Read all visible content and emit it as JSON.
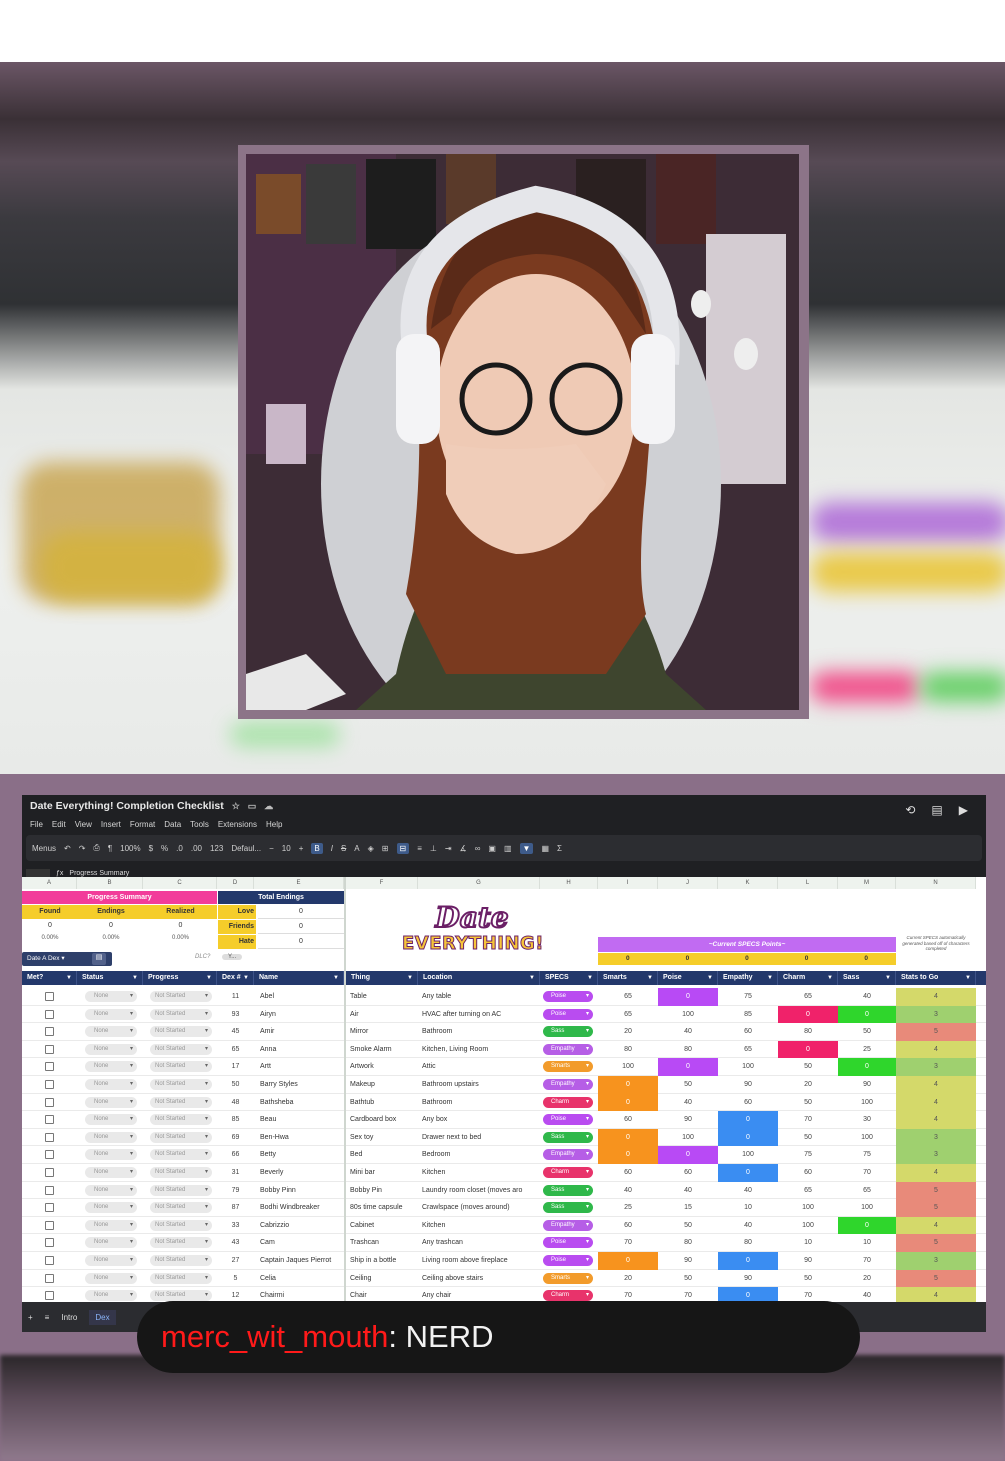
{
  "sheet": {
    "title": "Date Everything! Completion Checklist",
    "menus": [
      "File",
      "Edit",
      "View",
      "Insert",
      "Format",
      "Data",
      "Tools",
      "Extensions",
      "Help"
    ],
    "toolbar": {
      "menus_label": "Menus",
      "zoom": "100%",
      "currency": "$",
      "percent": "%",
      "dec_dec": ".0",
      "inc_dec": ".00",
      "num_fmt": "123",
      "font": "Defaul...",
      "font_size": "10"
    },
    "cell_ref_content": "Progress Summary",
    "progress_summary": {
      "title": "Progress Summary",
      "headers": [
        "Found",
        "Endings",
        "Realized"
      ],
      "counts": [
        "0",
        "0",
        "0"
      ],
      "percents": [
        "0.00%",
        "0.00%",
        "0.00%"
      ]
    },
    "total_endings": {
      "title": "Total Endings",
      "rows": [
        {
          "label": "Love",
          "value": "0"
        },
        {
          "label": "Friends",
          "value": "0"
        },
        {
          "label": "Hate",
          "value": "0"
        }
      ]
    },
    "filter_label": "Date A Dex",
    "dlc_label": "DLC?",
    "dlc_value": "Y...",
    "logo_line1": "Date",
    "logo_line2": "EVERYTHING!",
    "specs_title": "~Current SPECS Points~",
    "specs_values": [
      "0",
      "0",
      "0",
      "0",
      "0"
    ],
    "specs_note": "Current SPECS automatically generated based off of characters completed",
    "col_letters": [
      "A",
      "B",
      "C",
      "D",
      "E",
      "F",
      "G",
      "H",
      "I",
      "J",
      "K",
      "L",
      "M",
      "N"
    ],
    "headers": [
      "Met?",
      "Status",
      "Progress",
      "Dex #",
      "Name",
      "Thing",
      "Location",
      "SPECS",
      "Smarts",
      "Poise",
      "Empathy",
      "Charm",
      "Sass",
      "Stats to Go"
    ],
    "rows": [
      {
        "status": "None",
        "progress": "Not Started",
        "dex": "11",
        "name": "Abel",
        "thing": "Table",
        "location": "Any table",
        "spec": "Poise",
        "smarts": "65",
        "poise": "0",
        "empathy": "75",
        "charm": "65",
        "sass": "40",
        "togo": "4"
      },
      {
        "status": "None",
        "progress": "Not Started",
        "dex": "93",
        "name": "Airyn",
        "thing": "Air",
        "location": "HVAC after turning on AC",
        "spec": "Poise",
        "smarts": "65",
        "poise": "100",
        "empathy": "85",
        "charm": "0",
        "sass": "0",
        "togo": "3"
      },
      {
        "status": "None",
        "progress": "Not Started",
        "dex": "45",
        "name": "Amir",
        "thing": "Mirror",
        "location": "Bathroom",
        "spec": "Sass",
        "smarts": "20",
        "poise": "40",
        "empathy": "60",
        "charm": "80",
        "sass": "50",
        "togo": "5"
      },
      {
        "status": "None",
        "progress": "Not Started",
        "dex": "65",
        "name": "Anna",
        "thing": "Smoke Alarm",
        "location": "Kitchen, Living Room",
        "spec": "Empathy",
        "smarts": "80",
        "poise": "80",
        "empathy": "65",
        "charm": "0",
        "sass": "25",
        "togo": "4"
      },
      {
        "status": "None",
        "progress": "Not Started",
        "dex": "17",
        "name": "Artt",
        "thing": "Artwork",
        "location": "Attic",
        "spec": "Smarts",
        "smarts": "100",
        "poise": "0",
        "empathy": "100",
        "charm": "50",
        "sass": "0",
        "togo": "3"
      },
      {
        "status": "None",
        "progress": "Not Started",
        "dex": "50",
        "name": "Barry Styles",
        "thing": "Makeup",
        "location": "Bathroom upstairs",
        "spec": "Empathy",
        "smarts": "0",
        "poise": "50",
        "empathy": "90",
        "charm": "20",
        "sass": "90",
        "togo": "4"
      },
      {
        "status": "None",
        "progress": "Not Started",
        "dex": "48",
        "name": "Bathsheba",
        "thing": "Bathtub",
        "location": "Bathroom",
        "spec": "Charm",
        "smarts": "0",
        "poise": "40",
        "empathy": "60",
        "charm": "50",
        "sass": "100",
        "togo": "4"
      },
      {
        "status": "None",
        "progress": "Not Started",
        "dex": "85",
        "name": "Beau",
        "thing": "Cardboard box",
        "location": "Any box",
        "spec": "Poise",
        "smarts": "60",
        "poise": "90",
        "empathy": "0",
        "charm": "70",
        "sass": "30",
        "togo": "4"
      },
      {
        "status": "None",
        "progress": "Not Started",
        "dex": "69",
        "name": "Ben-Hwa",
        "thing": "Sex toy",
        "location": "Drawer next to bed",
        "spec": "Sass",
        "smarts": "0",
        "poise": "100",
        "empathy": "0",
        "charm": "50",
        "sass": "100",
        "togo": "3"
      },
      {
        "status": "None",
        "progress": "Not Started",
        "dex": "66",
        "name": "Betty",
        "thing": "Bed",
        "location": "Bedroom",
        "spec": "Empathy",
        "smarts": "0",
        "poise": "0",
        "empathy": "100",
        "charm": "75",
        "sass": "75",
        "togo": "3"
      },
      {
        "status": "None",
        "progress": "Not Started",
        "dex": "31",
        "name": "Beverly",
        "thing": "Mini bar",
        "location": "Kitchen",
        "spec": "Charm",
        "smarts": "60",
        "poise": "60",
        "empathy": "0",
        "charm": "60",
        "sass": "70",
        "togo": "4"
      },
      {
        "status": "None",
        "progress": "Not Started",
        "dex": "79",
        "name": "Bobby Pinn",
        "thing": "Bobby Pin",
        "location": "Laundry room closet (moves aro",
        "spec": "Sass",
        "smarts": "40",
        "poise": "40",
        "empathy": "40",
        "charm": "65",
        "sass": "65",
        "togo": "5"
      },
      {
        "status": "None",
        "progress": "Not Started",
        "dex": "87",
        "name": "Bodhi Windbreaker",
        "thing": "80s time capsule",
        "location": "Crawlspace (moves around)",
        "spec": "Sass",
        "smarts": "25",
        "poise": "15",
        "empathy": "10",
        "charm": "100",
        "sass": "100",
        "togo": "5"
      },
      {
        "status": "None",
        "progress": "Not Started",
        "dex": "33",
        "name": "Cabrizzio",
        "thing": "Cabinet",
        "location": "Kitchen",
        "spec": "Empathy",
        "smarts": "60",
        "poise": "50",
        "empathy": "40",
        "charm": "100",
        "sass": "0",
        "togo": "4"
      },
      {
        "status": "None",
        "progress": "Not Started",
        "dex": "43",
        "name": "Cam",
        "thing": "Trashcan",
        "location": "Any trashcan",
        "spec": "Poise",
        "smarts": "70",
        "poise": "80",
        "empathy": "80",
        "charm": "10",
        "sass": "10",
        "togo": "5"
      },
      {
        "status": "None",
        "progress": "Not Started",
        "dex": "27",
        "name": "Captain Jaques Pierrot",
        "thing": "Ship in a bottle",
        "location": "Living room above fireplace",
        "spec": "Poise",
        "smarts": "0",
        "poise": "90",
        "empathy": "0",
        "charm": "90",
        "sass": "70",
        "togo": "3"
      },
      {
        "status": "None",
        "progress": "Not Started",
        "dex": "5",
        "name": "Celia",
        "thing": "Ceiling",
        "location": "Ceiling above stairs",
        "spec": "Smarts",
        "smarts": "20",
        "poise": "50",
        "empathy": "90",
        "charm": "50",
        "sass": "20",
        "togo": "5"
      },
      {
        "status": "None",
        "progress": "Not Started",
        "dex": "12",
        "name": "Chairmi",
        "thing": "Chair",
        "location": "Any chair",
        "spec": "Charm",
        "smarts": "70",
        "poise": "70",
        "empathy": "0",
        "charm": "70",
        "sass": "40",
        "togo": "4"
      }
    ],
    "tabs": [
      "Intro",
      "Dex"
    ]
  },
  "colors": {
    "Poise": "#b94cf0",
    "Sass": "#2fb84a",
    "Empathy": "#b65ee6",
    "Smarts": "#f29b2b",
    "Charm": "#e8336b",
    "smarts_hi": "#f7931e",
    "poise_hi": "#b84af5",
    "empathy_hi": "#3a8df2",
    "charm_hi": "#f0226a",
    "sass_hi": "#2fd62c",
    "togo_4": "#d4d96a",
    "togo_3": "#9fd06f",
    "togo_5": "#e88a7a"
  },
  "chat": {
    "user": "merc_wit_mouth",
    "separator": ":",
    "message": " NERD"
  }
}
